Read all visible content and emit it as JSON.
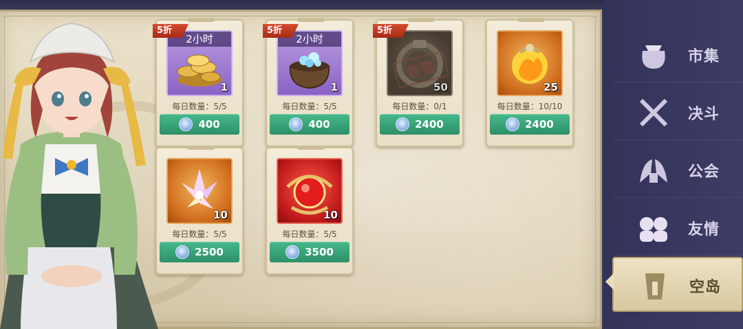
{
  "shop": {
    "items": [
      {
        "badge": "5折",
        "duration": "2小时",
        "qty": "1",
        "daily": "每日数量：5/5",
        "price": "400",
        "icon": "gold-coins-icon"
      },
      {
        "badge": "5折",
        "duration": "2小时",
        "qty": "1",
        "daily": "每日数量：5/5",
        "price": "400",
        "icon": "crystal-pouch-icon"
      },
      {
        "badge": "5折",
        "duration": "",
        "qty": "50",
        "daily": "每日数量：0/1",
        "price": "2400",
        "icon": "bronze-ring-icon",
        "sold": "售罄"
      },
      {
        "badge": "",
        "duration": "",
        "qty": "25",
        "daily": "每日数量：10/10",
        "price": "2400",
        "icon": "fire-orb-icon"
      },
      {
        "badge": "",
        "duration": "",
        "qty": "10",
        "daily": "每日数量：5/5",
        "price": "2500",
        "icon": "crystal-cluster-icon"
      },
      {
        "badge": "",
        "duration": "",
        "qty": "10",
        "daily": "每日数量：5/5",
        "price": "3500",
        "icon": "red-gem-icon"
      }
    ]
  },
  "sidebar": {
    "items": [
      {
        "label": "市集",
        "icon": "bag-icon"
      },
      {
        "label": "决斗",
        "icon": "crossed-swords-icon"
      },
      {
        "label": "公会",
        "icon": "dragons-icon"
      },
      {
        "label": "友情",
        "icon": "friends-icon"
      },
      {
        "label": "空岛",
        "icon": "tower-icon",
        "active": true
      }
    ]
  },
  "colors": {
    "price_button": "#3aa57a",
    "badge": "#c23a22",
    "sidebar_bg": "#36365c",
    "parchment": "#e6dcc2"
  }
}
